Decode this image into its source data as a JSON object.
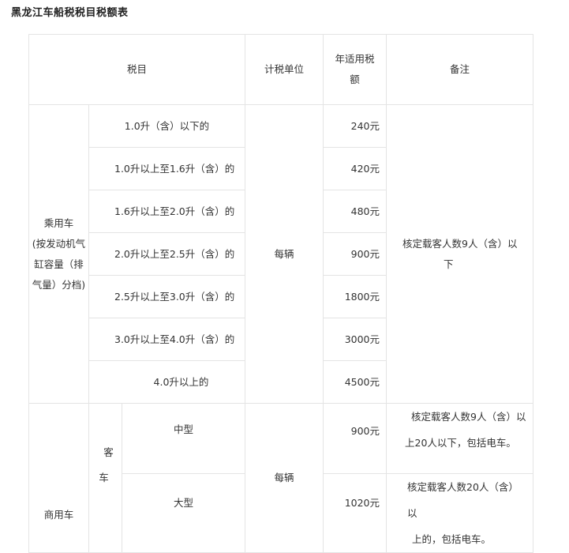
{
  "page": {
    "title": "黑龙江车船税税目税额表"
  },
  "table": {
    "headers": {
      "item": "税目",
      "unit": "计税单位",
      "annual_rate": "年适用税额",
      "annual_rate_line1": "年适用税",
      "annual_rate_line2": "额",
      "note": "备注"
    },
    "passenger": {
      "category_lines": [
        "乘用车",
        "(按发动机气",
        "缸容量（排",
        "气量）分档)"
      ],
      "unit": "每辆",
      "note": "核定载客人数9人（含）以下",
      "note_line1": "核定载客人数9人（含）以",
      "note_line2": "下",
      "rows": [
        {
          "label": "1.0升（含）以下的",
          "tax": "240元"
        },
        {
          "label": "1.0升以上至1.6升（含）的",
          "tax": "420元"
        },
        {
          "label": "1.6升以上至2.0升（含）的",
          "tax": "480元"
        },
        {
          "label": "2.0升以上至2.5升（含）的",
          "tax": "900元"
        },
        {
          "label": "2.5升以上至3.0升（含）的",
          "tax": "1800元"
        },
        {
          "label": "3.0升以上至4.0升（含）的",
          "tax": "3000元"
        },
        {
          "label": "4.0升以上的",
          "tax": "4500元"
        }
      ]
    },
    "commercial": {
      "category": "商用车",
      "sub_line1": "客",
      "sub_line2": "车",
      "unit": "每辆",
      "rows": [
        {
          "label": "中型",
          "tax": "900元",
          "note_line1": "核定载客人数9人（含）以",
          "note_line2": "上20人以下，包括电车。"
        },
        {
          "label": "大型",
          "tax": "1020元",
          "note_line1": "核定载客人数20人（含）以",
          "note_line2": "上的，包括电车。"
        }
      ]
    }
  }
}
